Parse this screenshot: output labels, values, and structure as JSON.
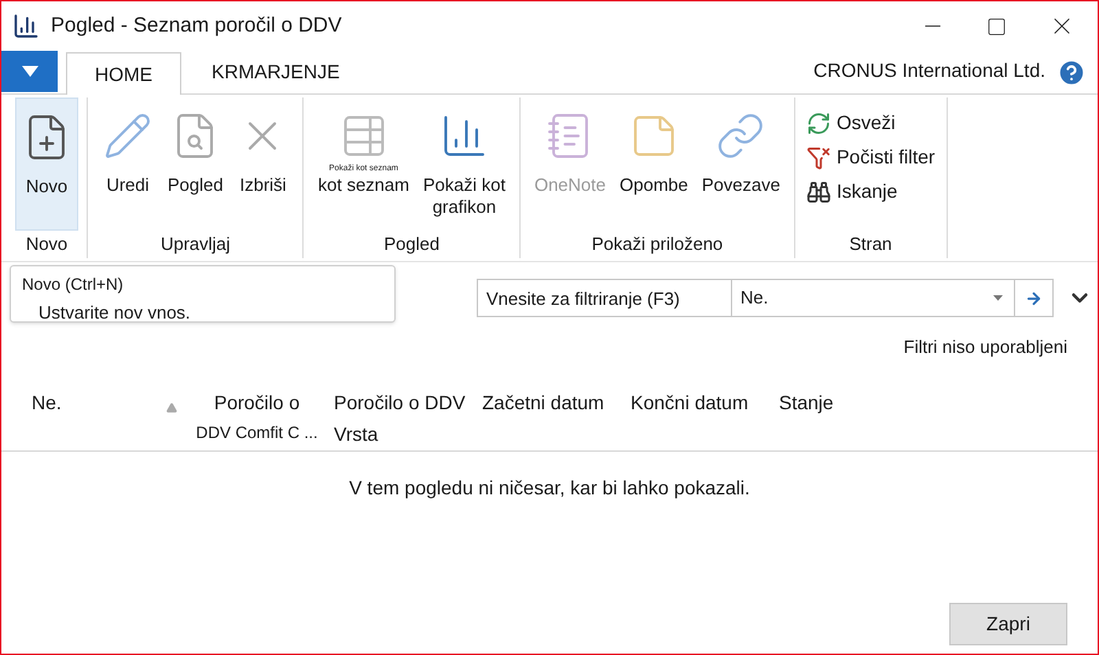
{
  "window": {
    "title": "Pogled - Seznam poročil o DDV"
  },
  "tabs": [
    {
      "label": "HOME",
      "selected": true
    },
    {
      "label": "KRMARJENJE",
      "selected": false
    }
  ],
  "company": "CRONUS International Ltd.",
  "ribbon": {
    "groups": [
      {
        "label": "Novo",
        "items": [
          {
            "kind": "large",
            "lines": [
              "Novo"
            ],
            "selected": true,
            "disabled": false
          }
        ]
      },
      {
        "label": "Upravljaj",
        "items": [
          {
            "kind": "large",
            "lines": [
              "Uredi"
            ],
            "selected": false,
            "disabled": false
          },
          {
            "kind": "large",
            "lines": [
              "Pogled"
            ],
            "selected": false,
            "disabled": false
          },
          {
            "kind": "large",
            "lines": [
              "Izbriši"
            ],
            "selected": false,
            "disabled": false
          }
        ]
      },
      {
        "label": "Pogled",
        "items": [
          {
            "kind": "large",
            "caption": "Pokaži kot seznam",
            "lines": [
              "kot seznam"
            ],
            "selected": false,
            "disabled": false
          },
          {
            "kind": "large",
            "lines": [
              "Pokaži kot",
              "grafikon"
            ],
            "selected": false,
            "disabled": false
          }
        ]
      },
      {
        "label": "Pokaži priloženo",
        "items": [
          {
            "kind": "large",
            "lines": [
              "OneNote"
            ],
            "selected": false,
            "disabled": true
          },
          {
            "kind": "large",
            "lines": [
              "Opombe"
            ],
            "selected": false,
            "disabled": false
          },
          {
            "kind": "large",
            "lines": [
              "Povezave"
            ],
            "selected": false,
            "disabled": false
          }
        ]
      },
      {
        "label": "Stran",
        "items": [
          {
            "kind": "small",
            "lines": [
              "Osveži"
            ],
            "selected": false,
            "disabled": false
          },
          {
            "kind": "small",
            "lines": [
              "Počisti filter"
            ],
            "selected": false,
            "disabled": false
          },
          {
            "kind": "small",
            "lines": [
              "Iskanje"
            ],
            "selected": false,
            "disabled": false
          }
        ]
      }
    ]
  },
  "tooltip": {
    "title": "Novo (Ctrl+N)",
    "text": "Ustvarite nov vnos."
  },
  "filter": {
    "placeholder": "Vnesite za filtriranje (F3)",
    "field": "Ne."
  },
  "filter_status": "Filtri niso uporabljeni",
  "table": {
    "columns": [
      {
        "lines": [
          "Ne."
        ],
        "sorted": true
      },
      {
        "lines": [
          "Poročilo o",
          "DDV Comfit C ..."
        ],
        "sorted": false
      },
      {
        "lines": [
          "Poročilo o DDV",
          "Vrsta"
        ],
        "sorted": false
      },
      {
        "lines": [
          "Začetni datum"
        ],
        "sorted": false
      },
      {
        "lines": [
          "Končni datum"
        ],
        "sorted": false
      },
      {
        "lines": [
          "Stanje"
        ],
        "sorted": false
      }
    ],
    "empty_message": "V tem pogledu ni ničesar, kar bi lahko pokazali."
  },
  "buttons": [
    "Zapri"
  ]
}
